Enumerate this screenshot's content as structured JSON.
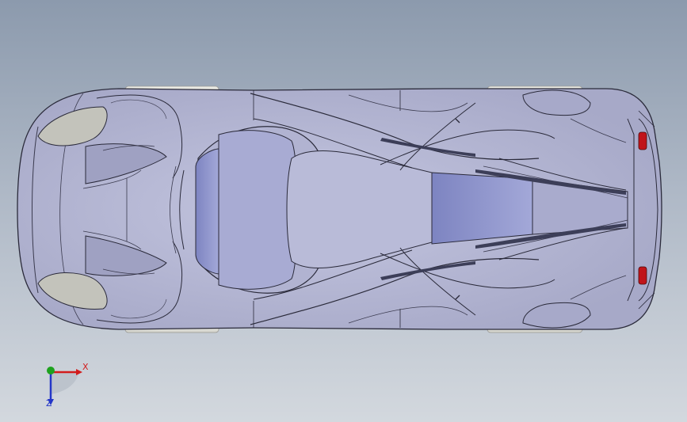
{
  "viewport": {
    "background_top": "#8c9aad",
    "background_bottom": "#d3d8de"
  },
  "model": {
    "body_color": "#b7b9d6",
    "glass_color": "#8f95c9",
    "tail_light_color": "#c0141a"
  },
  "triad": {
    "x_label": "X",
    "z_label": "Z",
    "x_color": "#d21c1c",
    "y_color": "#1ea21e",
    "z_color": "#2436c8"
  }
}
